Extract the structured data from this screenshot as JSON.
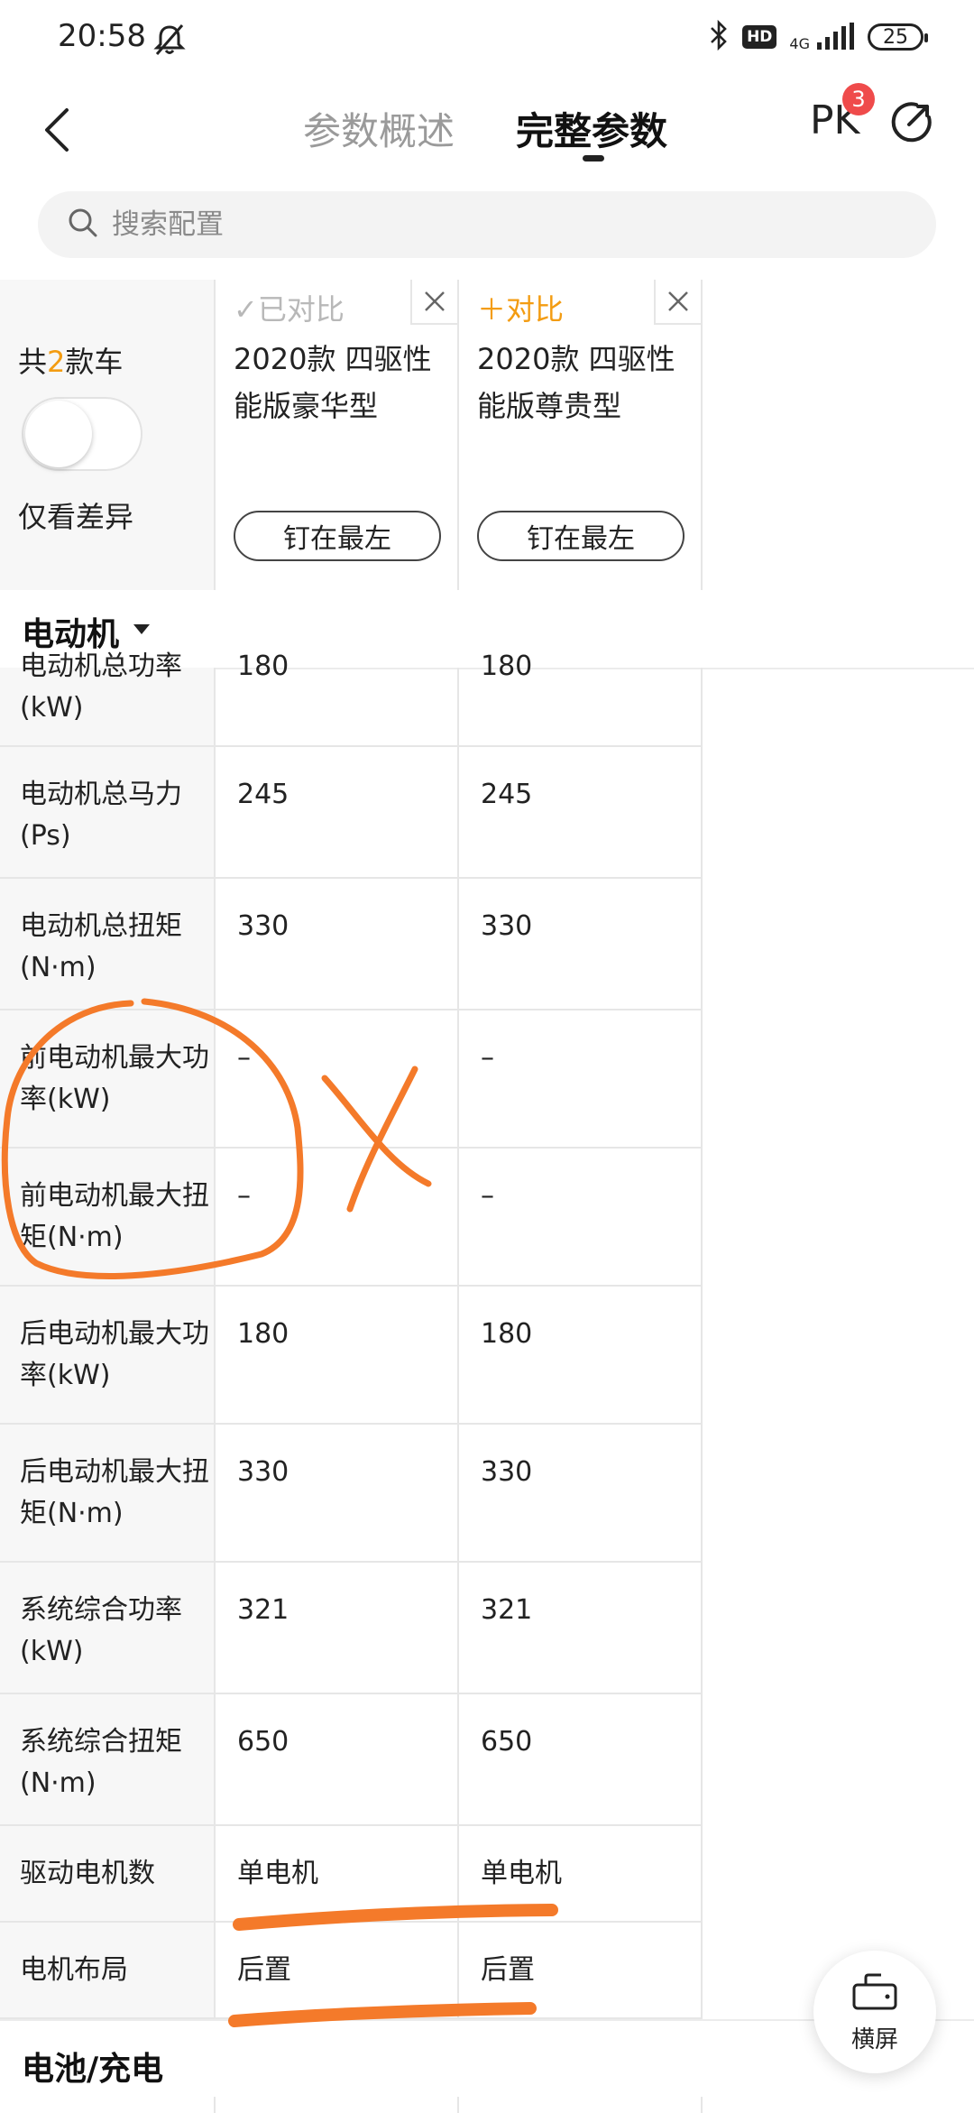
{
  "status_bar": {
    "time": "20:58",
    "hd": "HD",
    "network": "4G",
    "battery": "25",
    "icons": [
      "mute-icon",
      "bluetooth-icon",
      "signal-icon",
      "battery-icon"
    ]
  },
  "header": {
    "tabs": [
      {
        "label": "参数概述",
        "active": false
      },
      {
        "label": "完整参数",
        "active": true
      }
    ],
    "pk_label": "PK",
    "pk_count": "3"
  },
  "search": {
    "placeholder": "搜索配置"
  },
  "compare": {
    "count_prefix": "共",
    "count": "2",
    "count_suffix": "款车",
    "diff_toggle_label": "仅看差异",
    "diff_toggle_on": false,
    "cars": [
      {
        "status": "✓已对比",
        "name": "2020款 四驱性能版豪华型",
        "pin_label": "钉在最左"
      },
      {
        "status": "＋对比",
        "name": "2020款 四驱性能版尊贵型",
        "pin_label": "钉在最左"
      }
    ]
  },
  "sections": [
    {
      "title": "电动机"
    },
    {
      "title": "电池/充电"
    }
  ],
  "rows": [
    {
      "label": "电动机总功率(kW)",
      "v1": "180",
      "v2": "180"
    },
    {
      "label": "电动机总马力(Ps)",
      "v1": "245",
      "v2": "245"
    },
    {
      "label": "电动机总扭矩(N·m)",
      "v1": "330",
      "v2": "330"
    },
    {
      "label": "前电动机最大功率(kW)",
      "v1": "–",
      "v2": "–"
    },
    {
      "label": "前电动机最大扭矩(N·m)",
      "v1": "–",
      "v2": "–"
    },
    {
      "label": "后电动机最大功率(kW)",
      "v1": "180",
      "v2": "180"
    },
    {
      "label": "后电动机最大扭矩(N·m)",
      "v1": "330",
      "v2": "330"
    },
    {
      "label": "系统综合功率(kW)",
      "v1": "321",
      "v2": "321"
    },
    {
      "label": "系统综合扭矩(N·m)",
      "v1": "650",
      "v2": "650"
    },
    {
      "label": "驱动电机数",
      "v1": "单电机",
      "v2": "单电机"
    },
    {
      "label": "电机布局",
      "v1": "后置",
      "v2": "后置"
    }
  ],
  "landscape_label": "横屏",
  "annotation_color": "#f47a2a",
  "accent_color": "#f39c12",
  "badge_color": "#ef4b4b"
}
